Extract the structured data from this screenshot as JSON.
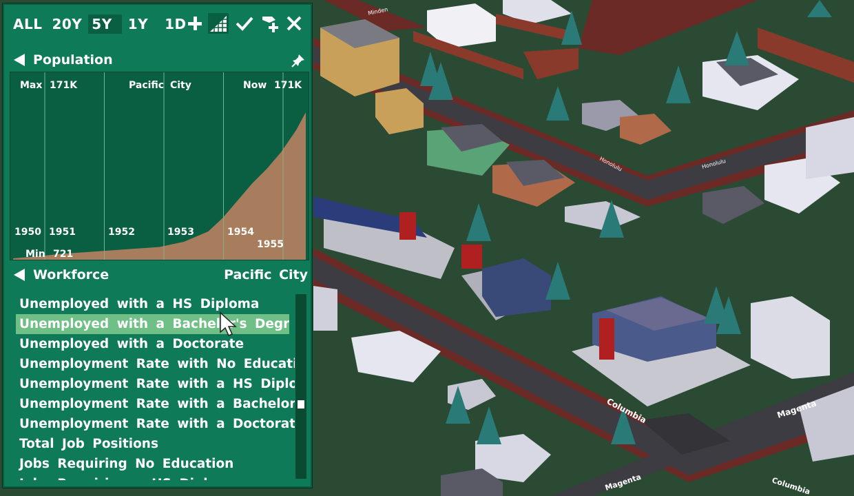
{
  "toolbar": {
    "timeframes": [
      "ALL",
      "20Y",
      "5Y",
      "1Y",
      "1D"
    ],
    "active_timeframe": "5Y",
    "icons": [
      "plus-icon",
      "chart-grid-icon",
      "checkmark-icon",
      "add-layer-icon",
      "close-icon"
    ]
  },
  "population": {
    "title": "Population",
    "pin_icon": "pin-icon",
    "max_label": "Max",
    "max_value": "171K",
    "city_name": "Pacific  City",
    "now_label": "Now",
    "now_value": "171K",
    "min_label": "Min",
    "min_value": "721",
    "year_labels": [
      "1950",
      "1951",
      "1952",
      "1953",
      "1954",
      "1955"
    ]
  },
  "chart_data": {
    "type": "area",
    "title": "Population",
    "x": [
      1950.0,
      1950.5,
      1951.0,
      1951.5,
      1952.0,
      1952.5,
      1953.0,
      1953.5,
      1954.0,
      1954.3,
      1954.6,
      1954.9,
      1955.2,
      1955.5,
      1955.8,
      1956.0
    ],
    "values": [
      721,
      3000,
      6000,
      8000,
      10000,
      12000,
      14000,
      20000,
      32000,
      48000,
      68000,
      88000,
      105000,
      125000,
      150000,
      171000
    ],
    "ylim": [
      721,
      171000
    ],
    "fill_color": "#a87d5e",
    "grid": true
  },
  "workforce": {
    "title": "Workforce",
    "city_name": "Pacific  City",
    "items": [
      "Unemployed with a HS Diploma",
      "Unemployed with a Bachelor's Degree",
      "Unemployed with a Doctorate",
      "Unemployment Rate with No Education",
      "Unemployment Rate with a HS Diploma",
      "Unemployment Rate with a Bachelor's Degree",
      "Unemployment Rate with a Doctorate",
      "Total Job Positions",
      "Jobs Requiring No Education",
      "Jobs Requiring a HS Diploma"
    ],
    "hovered_index": 1
  },
  "map": {
    "street_labels": [
      "Columbia",
      "Magenta",
      "Magenta",
      "Columbia",
      "Honolulu",
      "Honolulu",
      "Minden"
    ]
  },
  "colors": {
    "panel": "#0f7a57",
    "panel_dark": "#0a5e42",
    "highlight": "#6fbf86",
    "grass": "#2b4a34",
    "road": "#3a3a40",
    "road_edge": "#6b2a26"
  }
}
